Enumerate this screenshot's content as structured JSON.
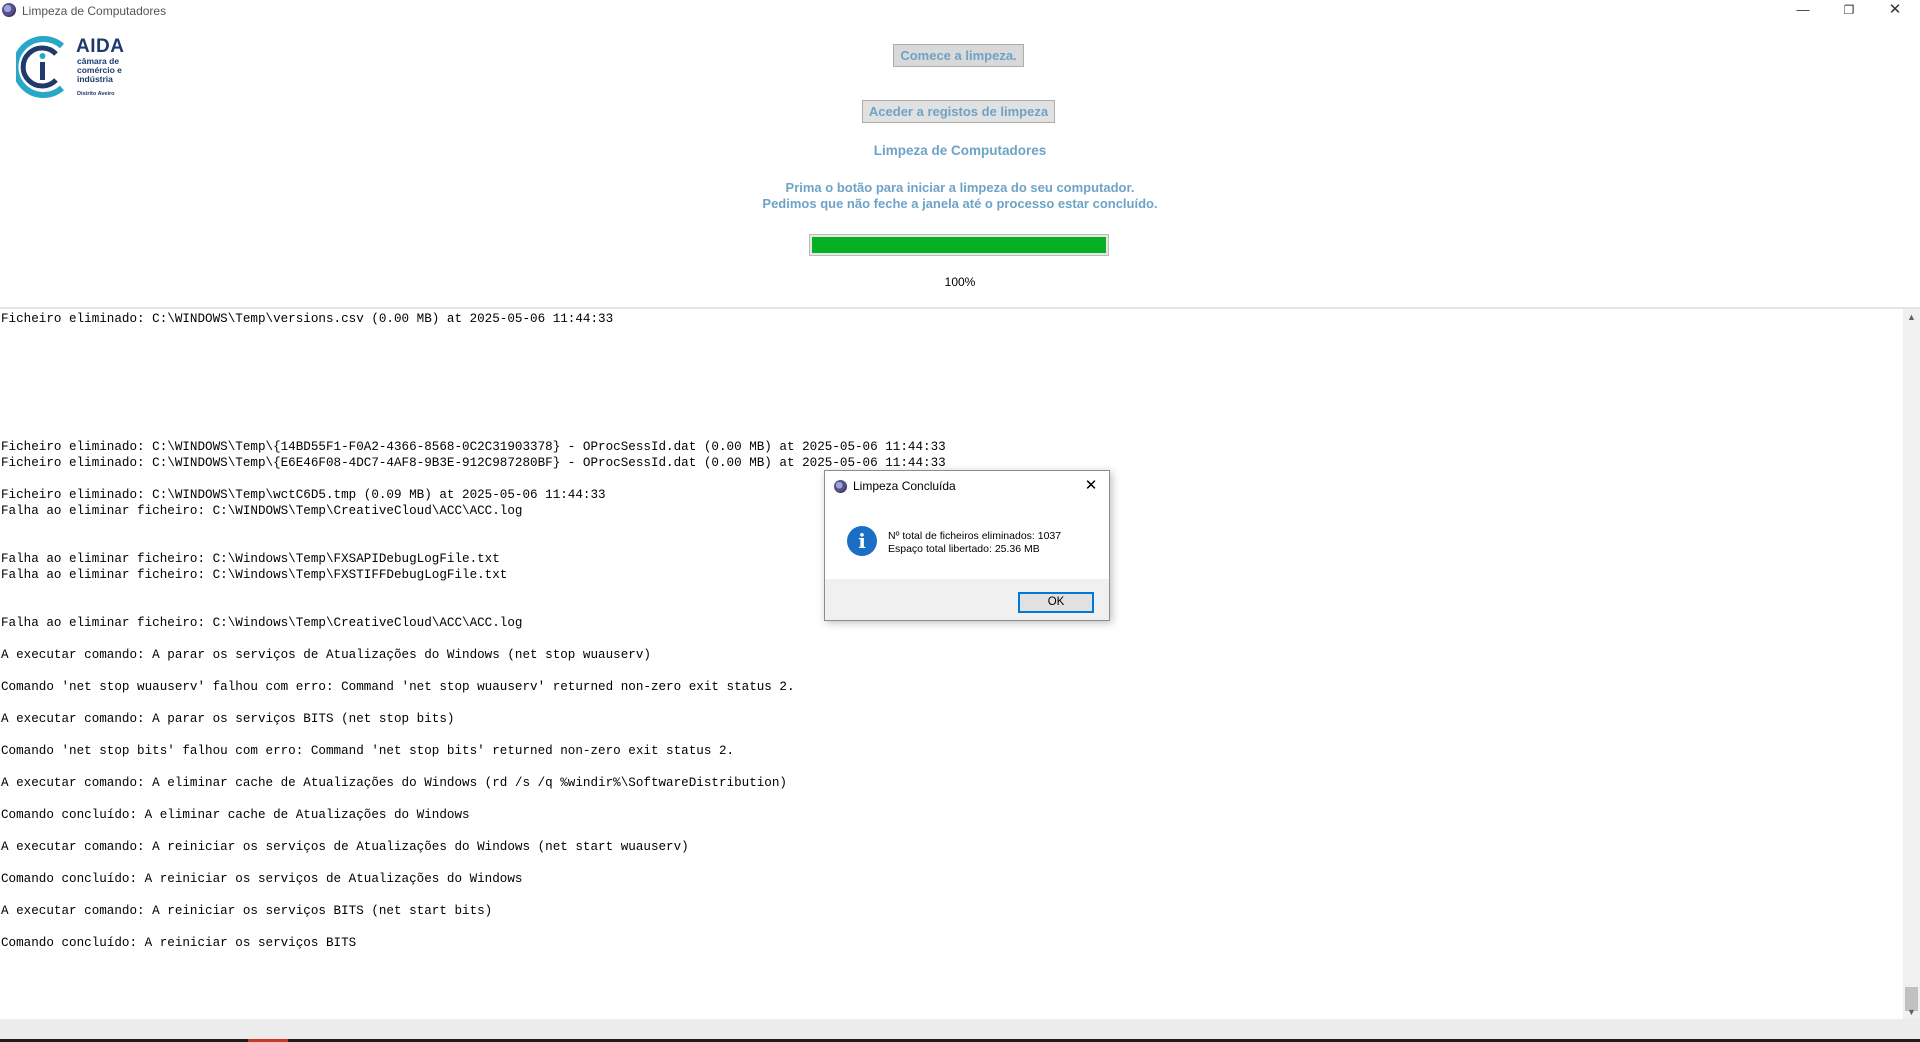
{
  "window": {
    "title": "Limpeza de Computadores",
    "minimize": "—",
    "maximize": "❐",
    "close": "✕"
  },
  "logo": {
    "name": "AIDA",
    "subtitle_line1": "câmara de",
    "subtitle_line2": "comércio e",
    "subtitle_line3": "indústria",
    "subtitle_line4": "Distrito Aveiro"
  },
  "controls": {
    "start_button": "Comece a limpeza.",
    "logs_button": "Aceder a registos de limpeza",
    "heading": "Limpeza de Computadores",
    "instruction_line1": "Prima o botão para iniciar a limpeza do seu computador.",
    "instruction_line2": "Pedimos que não feche a janela até o processo estar concluído.",
    "progress_percent": 100,
    "progress_label": "100%",
    "progress_color": "#06b025"
  },
  "log": {
    "lines": [
      "Ficheiro eliminado: C:\\WINDOWS\\Temp\\versions.csv (0.00 MB) at 2025-05-06 11:44:33",
      "",
      "",
      "",
      "",
      "",
      "",
      "",
      "Ficheiro eliminado: C:\\WINDOWS\\Temp\\{14BD55F1-F0A2-4366-8568-0C2C31903378} - OProcSessId.dat (0.00 MB) at 2025-05-06 11:44:33",
      "Ficheiro eliminado: C:\\WINDOWS\\Temp\\{E6E46F08-4DC7-4AF8-9B3E-912C987280BF} - OProcSessId.dat (0.00 MB) at 2025-05-06 11:44:33",
      "",
      "Ficheiro eliminado: C:\\WINDOWS\\Temp\\wctC6D5.tmp (0.09 MB) at 2025-05-06 11:44:33",
      "Falha ao eliminar ficheiro: C:\\WINDOWS\\Temp\\CreativeCloud\\ACC\\ACC.log",
      "",
      "",
      "Falha ao eliminar ficheiro: C:\\Windows\\Temp\\FXSAPIDebugLogFile.txt",
      "Falha ao eliminar ficheiro: C:\\Windows\\Temp\\FXSTIFFDebugLogFile.txt",
      "",
      "",
      "Falha ao eliminar ficheiro: C:\\Windows\\Temp\\CreativeCloud\\ACC\\ACC.log",
      "",
      "A executar comando: A parar os serviços de Atualizações do Windows (net stop wuauserv)",
      "",
      "Comando 'net stop wuauserv' falhou com erro: Command 'net stop wuauserv' returned non-zero exit status 2.",
      "",
      "A executar comando: A parar os serviços BITS (net stop bits)",
      "",
      "Comando 'net stop bits' falhou com erro: Command 'net stop bits' returned non-zero exit status 2.",
      "",
      "A executar comando: A eliminar cache de Atualizações do Windows (rd /s /q %windir%\\SoftwareDistribution)",
      "",
      "Comando concluído: A eliminar cache de Atualizações do Windows",
      "",
      "A executar comando: A reiniciar os serviços de Atualizações do Windows (net start wuauserv)",
      "",
      "Comando concluído: A reiniciar os serviços de Atualizações do Windows",
      "",
      "A executar comando: A reiniciar os serviços BITS (net start bits)",
      "",
      "Comando concluído: A reiniciar os serviços BITS"
    ],
    "scroll_up": "▲",
    "scroll_down": "▼"
  },
  "dialog": {
    "title": "Limpeza Concluída",
    "close": "✕",
    "info_glyph": "i",
    "message_line1": "Nº total de ficheiros eliminados: 1037",
    "message_line2": "Espaço total libertado: 25.36 MB",
    "ok_label": "OK"
  }
}
